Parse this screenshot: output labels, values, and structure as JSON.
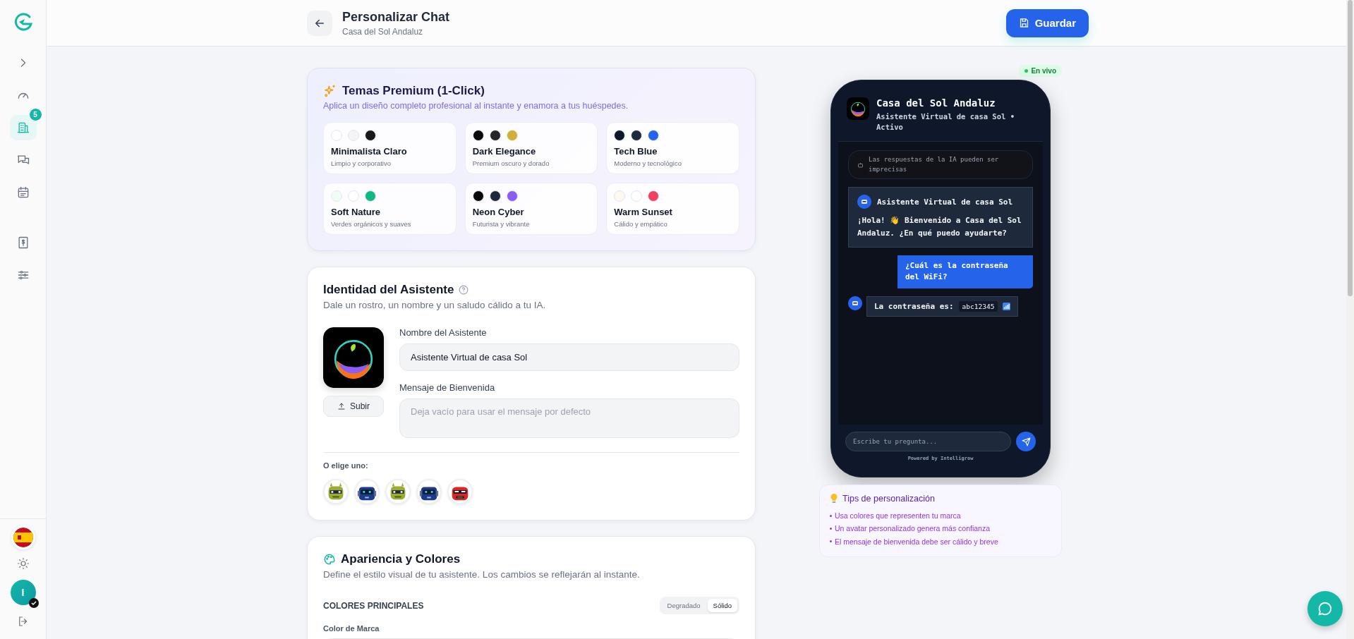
{
  "sidebar": {
    "items": [
      {
        "kind": "expand",
        "selected": false
      },
      {
        "kind": "gauge",
        "selected": false
      },
      {
        "kind": "building",
        "selected": true,
        "badge": "5"
      },
      {
        "kind": "chat",
        "selected": false
      },
      {
        "kind": "calendar",
        "selected": false
      },
      {
        "kind": "billing",
        "selected": false
      },
      {
        "kind": "sliders",
        "selected": false
      }
    ],
    "user": {
      "initial": "I"
    }
  },
  "header": {
    "title": "Personalizar Chat",
    "subtitle": "Casa del Sol Andaluz",
    "save_button": "Guardar"
  },
  "themes": {
    "title": "Temas Premium (1-Click)",
    "subtitle": "Aplica un diseño completo profesional al instante y enamora a tus huéspedes.",
    "items": [
      {
        "name": "Minimalista Claro",
        "description": "Limpio y corporativo",
        "swatches": [
          {
            "color": "#ffffff"
          },
          {
            "color": "#f3f4f6"
          },
          {
            "color": "#18181b"
          }
        ]
      },
      {
        "name": "Dark Elegance",
        "description": "Premium oscuro y dorado",
        "swatches": [
          {
            "color": "#0a0a0a"
          },
          {
            "color": "#262626"
          },
          {
            "color": "#d4af37"
          }
        ]
      },
      {
        "name": "Tech Blue",
        "description": "Moderno y tecnológico",
        "swatches": [
          {
            "color": "#0f172a"
          },
          {
            "color": "#1e293b"
          },
          {
            "color": "#2563eb"
          }
        ]
      },
      {
        "name": "Soft Nature",
        "description": "Verdes orgánicos y suaves",
        "swatches": [
          {
            "color": "#f0fdf4"
          },
          {
            "color": "#ffffff"
          },
          {
            "color": "#10b981"
          }
        ]
      },
      {
        "name": "Neon Cyber",
        "description": "Futurista y vibrante",
        "swatches": [
          {
            "color": "#09090b"
          },
          {
            "color": "#1e293b"
          },
          {
            "color": "#8b5cf6"
          }
        ]
      },
      {
        "name": "Warm Sunset",
        "description": "Cálido y empático",
        "swatches": [
          {
            "color": "#fdf8f0"
          },
          {
            "color": "#ffffff"
          },
          {
            "color": "#f43f5e"
          }
        ]
      }
    ]
  },
  "identity": {
    "title": "Identidad del Asistente",
    "subtitle": "Dale un rostro, un nombre y un saludo cálido a tu IA.",
    "upload_button": "Subir",
    "name_label": "Nombre del Asistente",
    "name_value": "Asistente Virtual de casa Sol",
    "welcome_label": "Mensaje de Bienvenida",
    "welcome_placeholder": "Deja vacío para usar el mensaje por defecto",
    "choose_label": "O elige uno:",
    "avatars": [
      {
        "kind": "goblin",
        "selected": false
      },
      {
        "kind": "blue-robot",
        "selected": false
      },
      {
        "kind": "goblin",
        "selected": false
      },
      {
        "kind": "blue-robot",
        "selected": false
      },
      {
        "kind": "red-robot",
        "selected": false
      }
    ]
  },
  "appearance": {
    "title": "Apariencia y Colores",
    "subtitle": "Define el estilo visual de tu asistente. Los cambios se reflejarán al instante.",
    "section_label": "COLORES PRINCIPALES",
    "fill_modes": [
      {
        "label": "Degradado",
        "selected": false
      },
      {
        "label": "Sólido",
        "selected": true
      }
    ],
    "brand_color_label": "Color de Marca"
  },
  "preview": {
    "badge": "En vivo",
    "chat_title": "Casa del Sol Andaluz",
    "chat_subtitle": "Asistente Virtual de casa Sol • Activo",
    "disclaimer": "Las respuestas de la IA pueden ser imprecisas",
    "messages": [
      {
        "kind": "bot-card",
        "sender": "Asistente Virtual de casa Sol",
        "text": "¡Hola! 👋 Bienvenido a Casa del Sol Andaluz. ¿En qué puedo ayudarte?"
      },
      {
        "kind": "user",
        "text": "¿Cuál es la contraseña del WiFi?"
      },
      {
        "kind": "bot",
        "text": "La contraseña es:",
        "code": "abc12345"
      }
    ],
    "input_placeholder": "Escribe tu pregunta...",
    "powered_by": "Powered by Intelligrow"
  },
  "tips": {
    "title": "Tips de personalización",
    "items": [
      "Usa colores que representen tu marca",
      "Un avatar personalizado genera más confianza",
      "El mensaje de bienvenida debe ser cálido y breve"
    ]
  }
}
